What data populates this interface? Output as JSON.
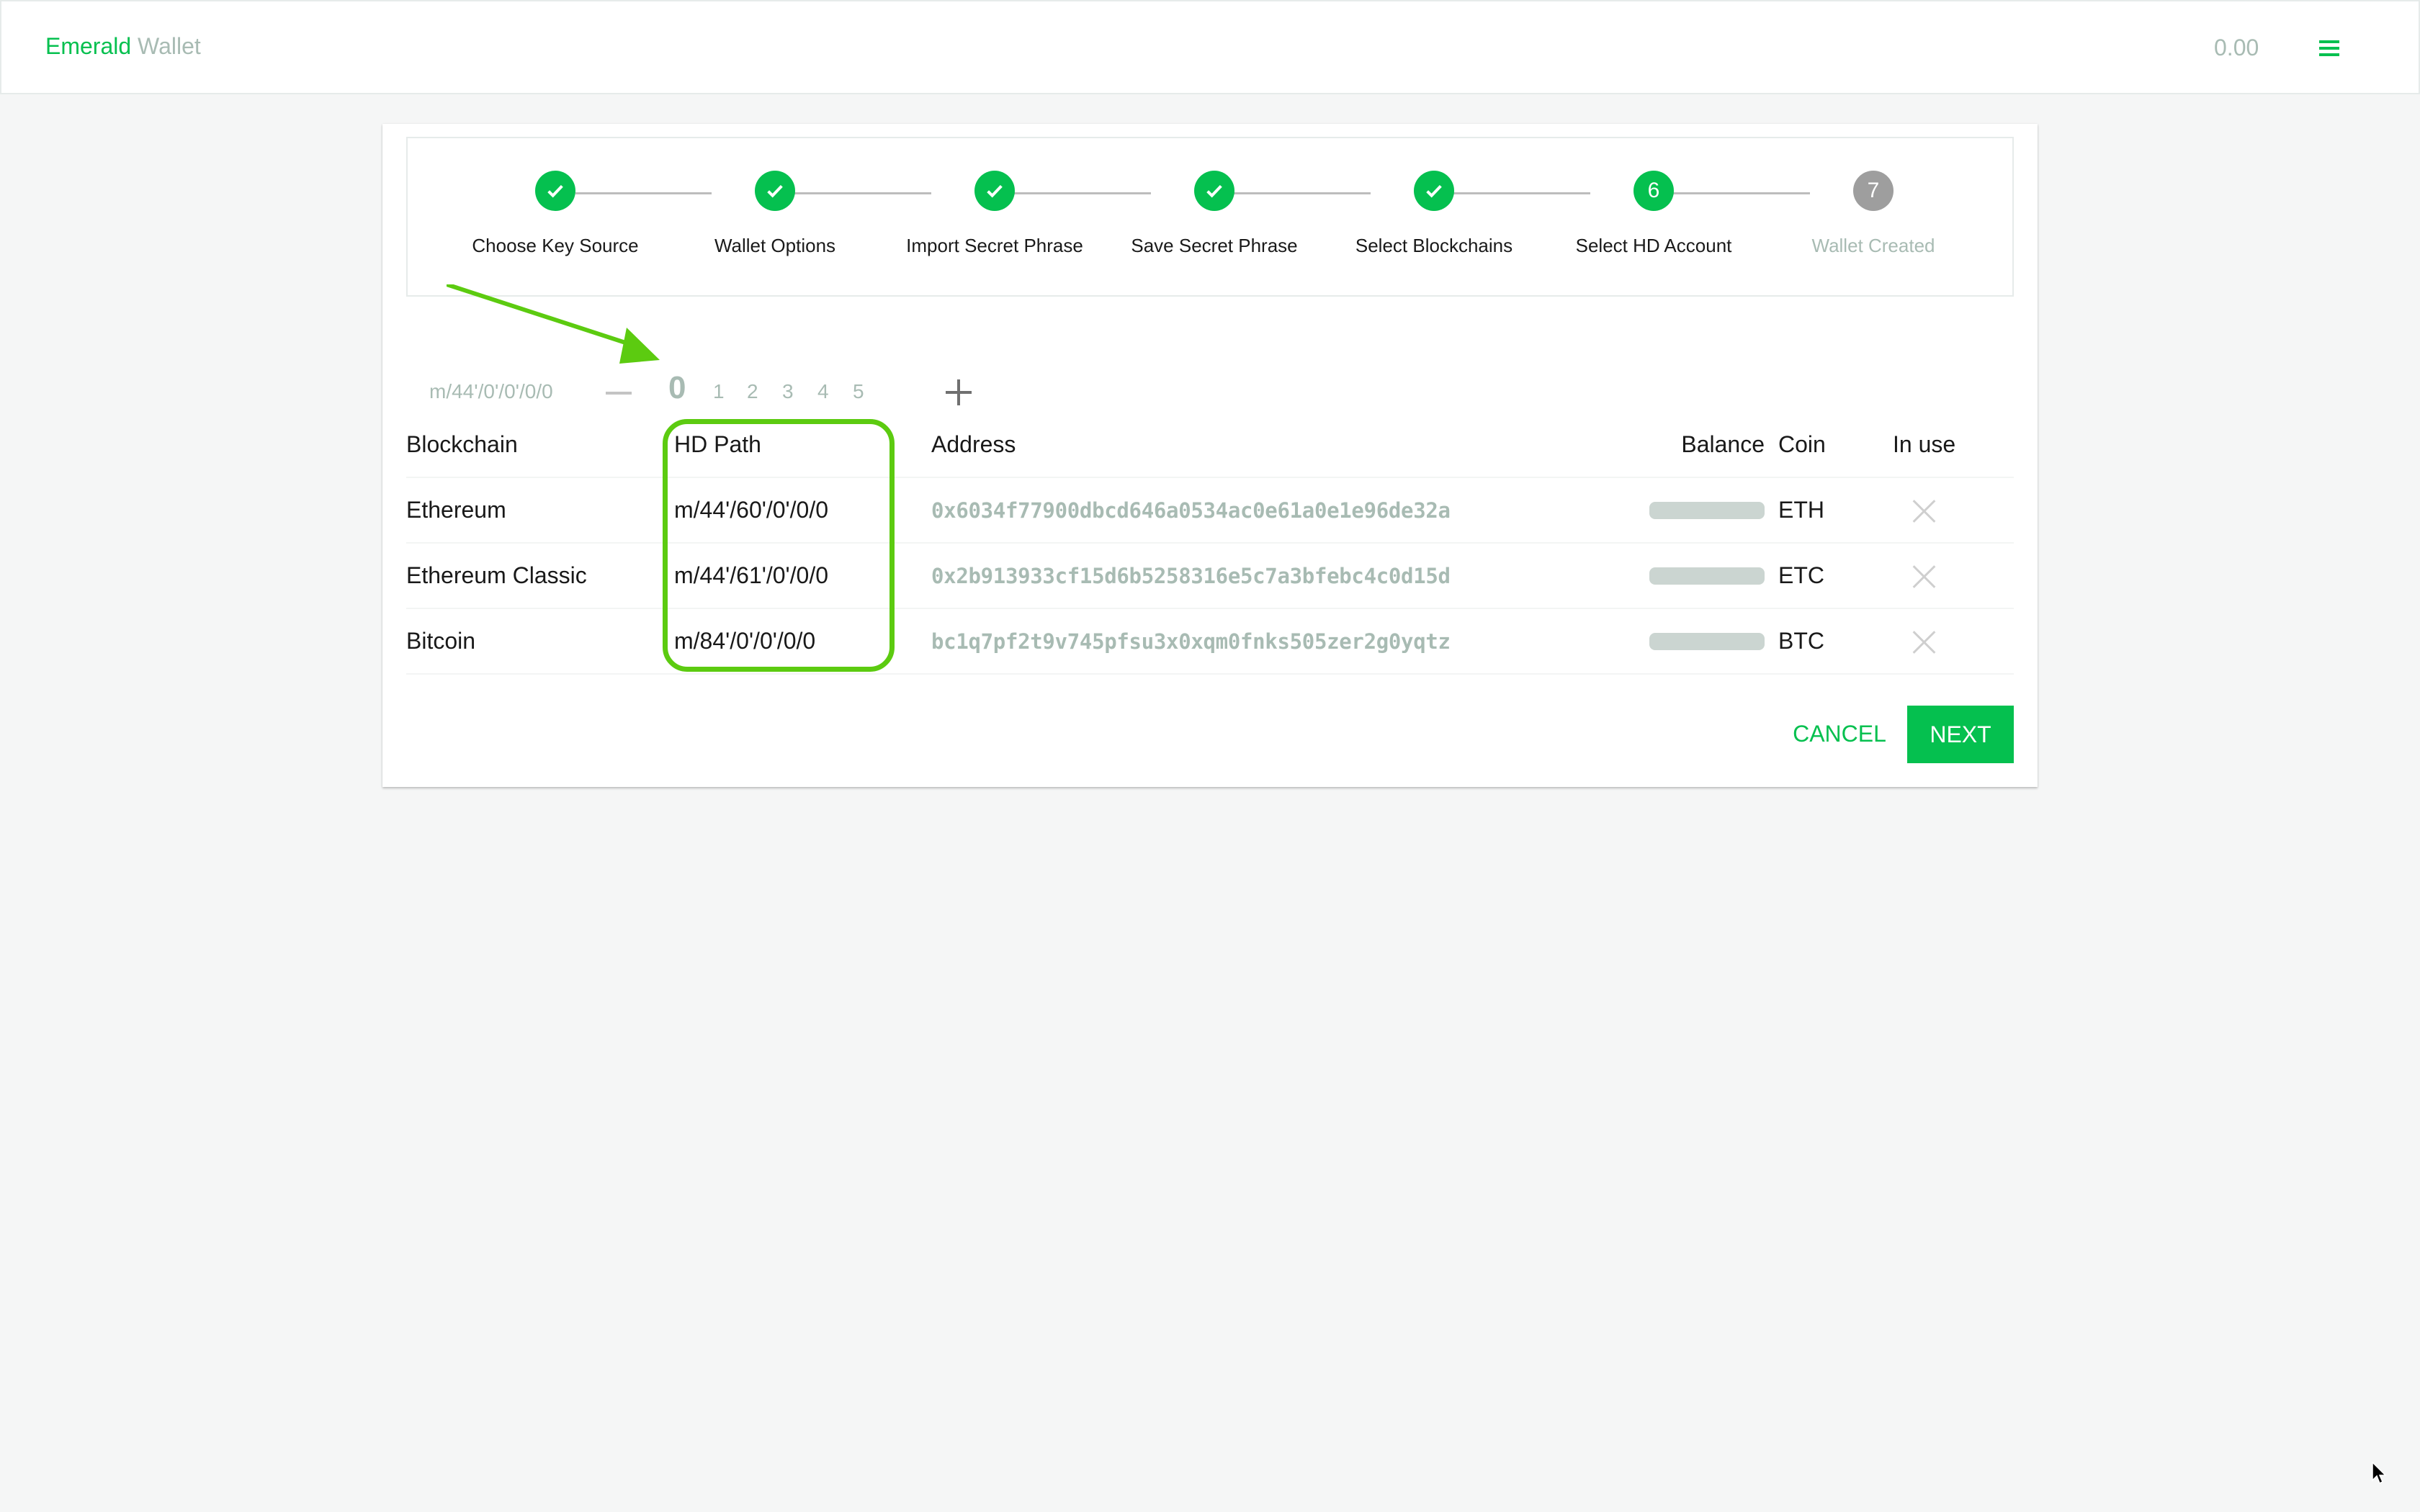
{
  "header": {
    "brand_primary": "Emerald",
    "brand_secondary": "Wallet",
    "balance": "0.00",
    "menu_icon": "hamburger-menu-icon"
  },
  "colors": {
    "accent": "#05c04f",
    "muted": "#a8bbb3",
    "pending_step": "#9e9e9e",
    "annotation": "#5ccb10"
  },
  "stepper": {
    "steps": [
      {
        "label": "Choose Key Source",
        "state": "complete",
        "marker": "check-icon"
      },
      {
        "label": "Wallet Options",
        "state": "complete",
        "marker": "check-icon"
      },
      {
        "label": "Import Secret Phrase",
        "state": "complete",
        "marker": "check-icon"
      },
      {
        "label": "Save Secret Phrase",
        "state": "complete",
        "marker": "check-icon"
      },
      {
        "label": "Select Blockchains",
        "state": "complete",
        "marker": "check-icon"
      },
      {
        "label": "Select HD Account",
        "state": "active",
        "marker": "6"
      },
      {
        "label": "Wallet Created",
        "state": "pending",
        "marker": "7"
      }
    ]
  },
  "account_selector": {
    "path_prefix": "m/44'/0'/0'/0/0",
    "accounts": [
      "0",
      "1",
      "2",
      "3",
      "4",
      "5"
    ],
    "selected": "0"
  },
  "table": {
    "columns": [
      "Blockchain",
      "HD Path",
      "Address",
      "Balance",
      "Coin",
      "In use"
    ],
    "rows": [
      {
        "blockchain": "Ethereum",
        "hd_path": "m/44'/60'/0'/0/0",
        "address": "0x6034f77900dbcd646a0534ac0e61a0e1e96de32a",
        "balance": "loading",
        "coin": "ETH",
        "in_use": false
      },
      {
        "blockchain": "Ethereum Classic",
        "hd_path": "m/44'/61'/0'/0/0",
        "address": "0x2b913933cf15d6b5258316e5c7a3bfebc4c0d15d",
        "balance": "loading",
        "coin": "ETC",
        "in_use": false
      },
      {
        "blockchain": "Bitcoin",
        "hd_path": "m/84'/0'/0'/0/0",
        "address": "bc1q7pf2t9v745pfsu3x0xqm0fnks505zer2g0yqtz",
        "balance": "loading",
        "coin": "BTC",
        "in_use": false
      }
    ]
  },
  "actions": {
    "cancel_label": "CANCEL",
    "next_label": "NEXT"
  }
}
